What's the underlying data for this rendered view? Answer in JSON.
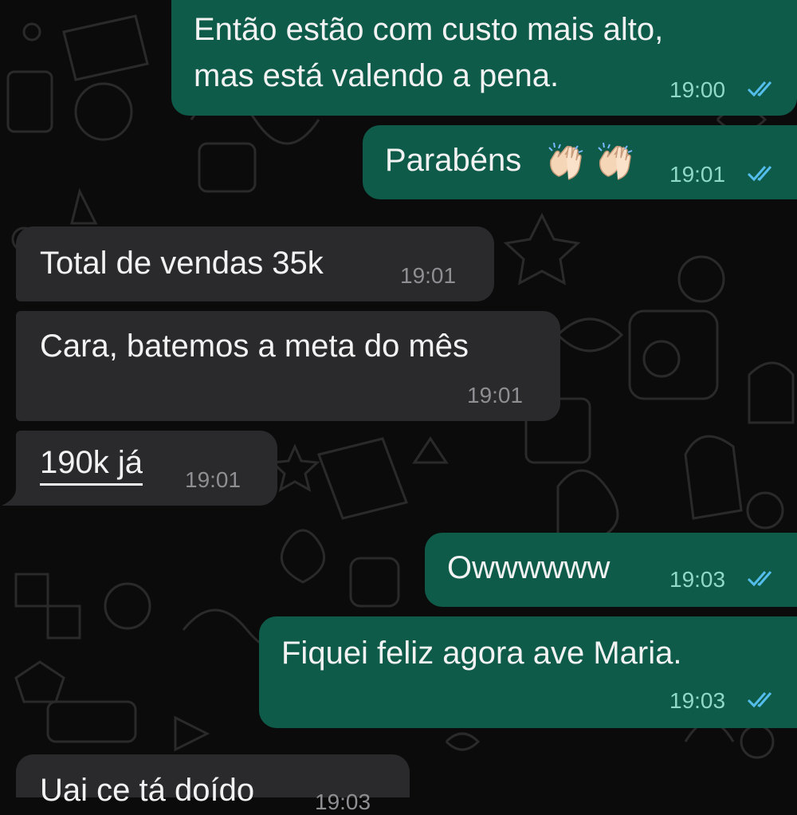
{
  "chat": {
    "messages": [
      {
        "id": "m1",
        "direction": "outgoing",
        "lines": [
          "Então estão com custo mais alto,",
          "mas está valendo a pena."
        ],
        "time": "19:00",
        "status": "read"
      },
      {
        "id": "m2",
        "direction": "outgoing",
        "text": "Parabéns",
        "emoji": [
          "clapping-hands",
          "clapping-hands"
        ],
        "time": "19:01",
        "status": "read"
      },
      {
        "id": "m3",
        "direction": "incoming",
        "text": "Total de vendas 35k",
        "time": "19:01"
      },
      {
        "id": "m4",
        "direction": "incoming",
        "text": "Cara, batemos a meta do mês",
        "time": "19:01"
      },
      {
        "id": "m5",
        "direction": "incoming",
        "text": "190k já",
        "time": "19:01"
      },
      {
        "id": "m6",
        "direction": "outgoing",
        "text": "Owwwwww",
        "time": "19:03",
        "status": "read"
      },
      {
        "id": "m7",
        "direction": "outgoing",
        "text": "Fiquei feliz agora ave Maria.",
        "time": "19:03",
        "status": "read"
      },
      {
        "id": "m8",
        "direction": "incoming",
        "text": "Uai ce tá doído",
        "time": "19:03"
      }
    ]
  },
  "colors": {
    "outgoing_bubble": "#0f5b4a",
    "incoming_bubble": "#2a2a2c",
    "read_ticks": "#53bdeb",
    "background": "#0b0b0b"
  },
  "icons": {
    "read_receipt": "double-check-icon",
    "reaction_emoji": "clapping-hands-icon"
  }
}
